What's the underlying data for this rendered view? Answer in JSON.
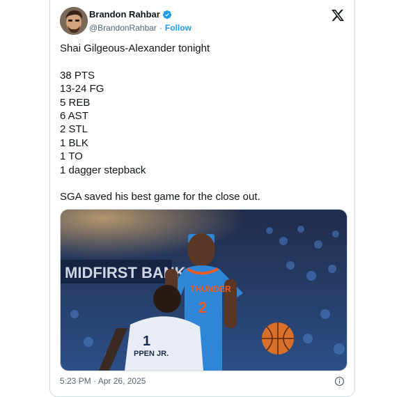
{
  "author": {
    "display_name": "Brandon Rahbar",
    "handle": "@BrandonRahbar",
    "separator": "·",
    "follow_label": "Follow",
    "verified": true
  },
  "tweet": {
    "headline": "Shai Gilgeous-Alexander tonight",
    "stats": [
      "38 PTS",
      "13-24 FG",
      "5 REB",
      "6 AST",
      "2 STL",
      "1 BLK",
      "1 TO",
      "1 dagger stepback"
    ],
    "closing": "SGA saved his best game for the close out."
  },
  "media": {
    "banner_text": "MIDFIRST BANK",
    "player_jersey_number": "2",
    "player_jersey_team": "THUNDER",
    "defender_jersey_number": "1",
    "defender_name": "PPEN JR."
  },
  "footer": {
    "timestamp": "5:23 PM · Apr 26, 2025"
  },
  "colors": {
    "brand": "#1d9bf0",
    "text": "#0f1419",
    "muted": "#536471",
    "thunder_blue": "#2f86d6",
    "thunder_orange": "#ef5b25"
  }
}
